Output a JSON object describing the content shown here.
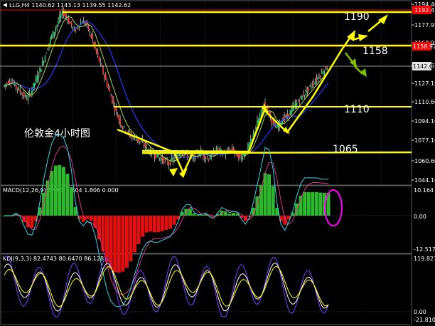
{
  "main_panel": {
    "header": "LLG,H4  1140.62 1143.13 1139.55 1142.62",
    "watermark": "伦敦金4小时图",
    "price_axis_labels": [
      "1194.40",
      "1177.95",
      "1160.95",
      "1142.62",
      "1127.15",
      "1110.60",
      "1094.10",
      "1077.10",
      "1060.60",
      "1044.10"
    ],
    "badges": {
      "red_top": "1192.4",
      "red_mid": "1158.92",
      "current": "1142.62"
    },
    "levels": [
      {
        "label": "1190",
        "price": 1190
      },
      {
        "label": "1158",
        "price": 1158
      },
      {
        "label": "1110",
        "price": 1110
      },
      {
        "label": "1065",
        "price": 1065
      }
    ],
    "colors": {
      "level_line": "#ffff00",
      "resistance_line": "#ff0000",
      "up_arrow": "#ffff00",
      "down_arrow": "#7fbf00",
      "circle": "#ff00ff"
    }
  },
  "macd_panel": {
    "header": "MACD(12,26,9) 5.993 4.604 1.806 0.000",
    "axis_labels": [
      "10.164",
      "0.00",
      "-12.517"
    ]
  },
  "kdj_panel": {
    "header": "KDJ(9,3,3) 82.4743 80.6470 86.1287",
    "axis_labels": [
      "119.8271",
      "0.00",
      "-21.8107"
    ]
  },
  "chart_data": {
    "type": "line",
    "x_unit": "bar index (H4)",
    "series": [
      {
        "values": [
          1125,
          1128,
          1130,
          1126,
          1122,
          1118,
          1115,
          1120,
          1128,
          1136,
          1145,
          1155,
          1165,
          1172,
          1180,
          1188,
          1184,
          1178,
          1172,
          1176,
          1180,
          1178,
          1170,
          1160,
          1150,
          1140,
          1130,
          1120,
          1110,
          1100,
          1092,
          1088,
          1084,
          1082,
          1080,
          1078,
          1074,
          1070,
          1068,
          1066,
          1064,
          1062,
          1060,
          1064,
          1066,
          1070,
          1068,
          1066,
          1064,
          1068,
          1070,
          1066,
          1064,
          1068,
          1072,
          1070,
          1068,
          1070,
          1072,
          1068,
          1064,
          1068,
          1074,
          1080,
          1092,
          1100,
          1110,
          1104,
          1096,
          1090,
          1094,
          1098,
          1100,
          1105,
          1110,
          1114,
          1118,
          1122,
          1126,
          1130,
          1134,
          1138,
          1142
        ]
      }
    ]
  }
}
